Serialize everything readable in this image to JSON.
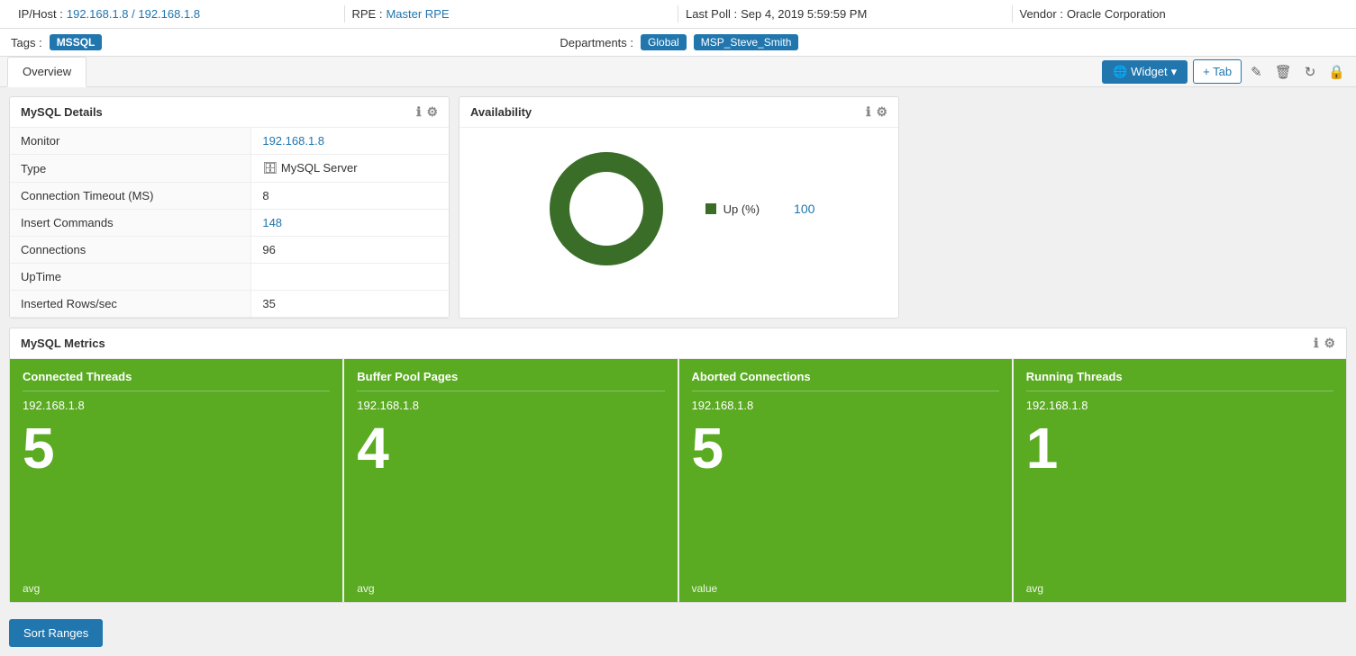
{
  "header": {
    "ip_label": "IP/Host :",
    "ip_value": "192.168.1.8 / 192.168.1.8",
    "rpe_label": "RPE :",
    "rpe_value": "Master RPE",
    "last_poll_label": "Last Poll :",
    "last_poll_value": "Sep 4, 2019 5:59:59 PM",
    "vendor_label": "Vendor :",
    "vendor_value": "Oracle Corporation"
  },
  "tags": {
    "label": "Tags :",
    "items": [
      "MSSQL"
    ],
    "departments_label": "Departments :",
    "departments": [
      "Global",
      "MSP_Steve_Smith"
    ]
  },
  "tabs": {
    "items": [
      {
        "label": "Overview",
        "active": true
      }
    ],
    "widget_button": "Widget",
    "tab_button": "+ Tab"
  },
  "mysql_details": {
    "title": "MySQL Details",
    "rows": [
      {
        "label": "Monitor",
        "value": "192.168.1.8",
        "type": "link"
      },
      {
        "label": "Type",
        "value": "MySQL Server",
        "type": "icon"
      },
      {
        "label": "Connection Timeout (MS)",
        "value": "8",
        "type": "text"
      },
      {
        "label": "Insert Commands",
        "value": "148",
        "type": "link"
      },
      {
        "label": "Connections",
        "value": "96",
        "type": "text"
      },
      {
        "label": "UpTime",
        "value": "",
        "type": "text"
      },
      {
        "label": "Inserted Rows/sec",
        "value": "35",
        "type": "text"
      }
    ]
  },
  "availability": {
    "title": "Availability",
    "legend": [
      {
        "label": "Up (%)",
        "color": "#3a6e28",
        "value": "100"
      }
    ],
    "donut": {
      "percentage": 100,
      "color": "#3a6e28",
      "bg_color": "#ddd"
    }
  },
  "mysql_metrics": {
    "title": "MySQL Metrics",
    "cards": [
      {
        "title": "Connected Threads",
        "host": "192.168.1.8",
        "value": "5",
        "footer": "avg"
      },
      {
        "title": "Buffer Pool Pages",
        "host": "192.168.1.8",
        "value": "4",
        "footer": "avg"
      },
      {
        "title": "Aborted Connections",
        "host": "192.168.1.8",
        "value": "5",
        "footer": "value"
      },
      {
        "title": "Running Threads",
        "host": "192.168.1.8",
        "value": "1",
        "footer": "avg"
      }
    ]
  },
  "sort_ranges": {
    "label": "Sort Ranges"
  },
  "icons": {
    "info": "ℹ",
    "gear": "⚙",
    "pencil": "✎",
    "trash": "🗑",
    "refresh": "↻",
    "lock": "🔒",
    "globe": "🌐",
    "caret_down": "▾",
    "plus": "+",
    "cylinder": "🗄"
  }
}
